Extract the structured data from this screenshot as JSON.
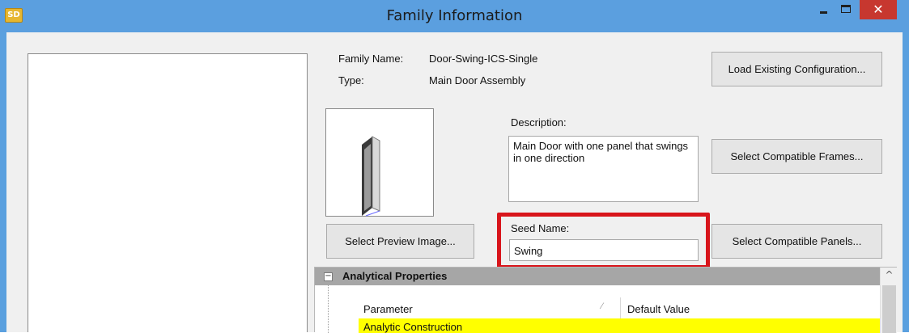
{
  "window": {
    "title": "Family Information",
    "app_icon_text": "SD",
    "minimize_glyph": "",
    "maximize_glyph": "",
    "close_glyph": "✕"
  },
  "info": {
    "family_name_label": "Family Name:",
    "family_name_value": "Door-Swing-ICS-Single",
    "type_label": "Type:",
    "type_value": "Main Door Assembly"
  },
  "buttons": {
    "load_existing": "Load Existing Configuration...",
    "select_frames": "Select Compatible Frames...",
    "select_preview": "Select Preview Image...",
    "select_panels": "Select Compatible Panels..."
  },
  "description": {
    "label": "Description:",
    "value": "Main Door with one panel that swings in one direction"
  },
  "seed": {
    "label": "Seed Name:",
    "value": "Swing"
  },
  "grid": {
    "category": "Analytical Properties",
    "expander_glyph": "−",
    "columns": [
      "Parameter",
      "Default Value"
    ],
    "rows": [
      {
        "parameter": "Analytic Construction",
        "default": ""
      }
    ],
    "scroll_up_glyph": "^"
  },
  "colors": {
    "titlebar": "#5b9fdf",
    "close_button": "#c7372f",
    "highlight_border": "#d8151b",
    "category_row": "#a6a6a6",
    "selected_row": "#ffff00"
  },
  "icons": [
    "app-logo-icon",
    "minimize-icon",
    "maximize-icon",
    "close-icon",
    "collapse-icon",
    "scroll-up-icon",
    "door-preview-icon"
  ]
}
